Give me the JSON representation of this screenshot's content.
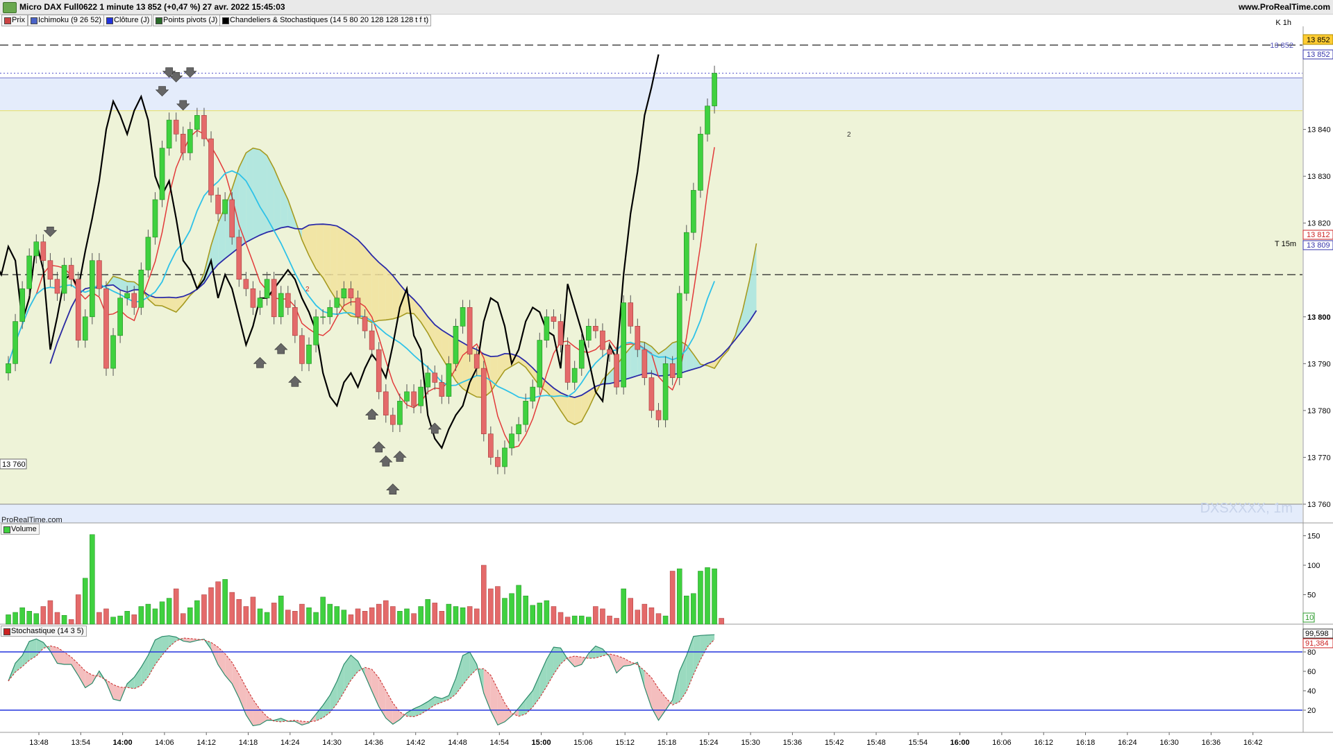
{
  "header": {
    "title": "Micro DAX Full0622 1 minute 13 852 (+0,47 %) 27 avr. 2022 15:45:03",
    "site": "www.ProRealTime.com"
  },
  "legend_tabs": [
    {
      "label": "Prix",
      "color": "#cc4444"
    },
    {
      "label": "Ichimoku (9 26 52)",
      "color": "#4a63c8"
    },
    {
      "label": "Clôture (J)",
      "color": "#2233dd"
    },
    {
      "label": "Points pivots (J)",
      "color": "#2a6b2a"
    },
    {
      "label": "Chandeliers & Stochastiques (14 5 80 20 128 128 128 t f t)",
      "color": "#000000"
    }
  ],
  "main_panel": {
    "watermark_brand": "ProRealTime.com",
    "watermark_symbol": "DXSXXXX, 1m",
    "level_k1h": "K 1h",
    "level_t15m": "T 15m",
    "price_tag_left": "13 760",
    "price_tags": [
      {
        "text": "13 852",
        "bg": "#ffcc33",
        "fg": "#000000"
      },
      {
        "text": "13 852",
        "bg": "#ffffff",
        "fg": "#3333aa"
      },
      {
        "text": "13 812",
        "bg": "#ffffff",
        "fg": "#cc2222"
      },
      {
        "text": "13 809",
        "bg": "#ffffff",
        "fg": "#3333aa"
      }
    ],
    "inline_label_852": "13 852",
    "marker_numbers": [
      "2",
      "2"
    ]
  },
  "volume_panel": {
    "label": "Volume",
    "last_tag": "10"
  },
  "stoch_panel": {
    "label": "Stochastique (14 3 5)",
    "tag_k": "99,598",
    "tag_d": "91,384"
  },
  "colors": {
    "up": "#3fd13f",
    "down": "#e46a6a",
    "ichimoku_cloud_green": "#a8e4e0",
    "ichimoku_cloud_red": "#f1e29c",
    "range_bg": "#eef3d8",
    "upper_band": "#e4ecfb"
  },
  "chart_data": {
    "type": "candlestick",
    "timeframe": "1 minute",
    "x_ticks": [
      "13:48",
      "13:54",
      "14:00",
      "14:06",
      "14:12",
      "14:18",
      "14:24",
      "14:30",
      "14:36",
      "14:42",
      "14:48",
      "14:54",
      "15:00",
      "15:06",
      "15:12",
      "15:18",
      "15:24",
      "15:30",
      "15:36",
      "15:42",
      "15:48",
      "15:54",
      "16:00",
      "16:06",
      "16:12",
      "16:18",
      "16:24",
      "16:30",
      "16:36",
      "16:42"
    ],
    "x_bold_ticks": [
      "14:00",
      "15:00",
      "16:00"
    ],
    "price_axis": {
      "ticks": [
        13760,
        13770,
        13780,
        13790,
        13800,
        13810,
        13820,
        13830,
        13840,
        13850
      ],
      "tick_labels": [
        "13 760",
        "13 770",
        "13 780",
        "13 790",
        "13 800",
        "13 820",
        "13 830",
        "13 840"
      ],
      "bold_tick": "13 800",
      "ylim": [
        13756,
        13862
      ]
    },
    "levels": {
      "k_1h": 13858,
      "upper_zone_top": 13851,
      "upper_zone_bottom": 13844,
      "t_15m": 13809,
      "range_low": 13760,
      "range_high": 13844
    },
    "candles_close": [
      13790,
      13799,
      13806,
      13813,
      13816,
      13812,
      13808,
      13805,
      13811,
      13808,
      13795,
      13800,
      13812,
      13806,
      13789,
      13796,
      13804,
      13805,
      13802,
      13810,
      13817,
      13825,
      13836,
      13842,
      13839,
      13835,
      13840,
      13843,
      13838,
      13826,
      13822,
      13825,
      13817,
      13808,
      13806,
      13802,
      13804,
      13808,
      13800,
      13805,
      13802,
      13796,
      13790,
      13794,
      13800,
      13800,
      13802,
      13804,
      13806,
      13804,
      13800,
      13797,
      13793,
      13784,
      13779,
      13777,
      13782,
      13784,
      13781,
      13785,
      13788,
      13786,
      13783,
      13790,
      13798,
      13802,
      13792,
      13789,
      13775,
      13770,
      13768,
      13772,
      13775,
      13777,
      13782,
      13785,
      13795,
      13800,
      13799,
      13794,
      13786,
      13789,
      13795,
      13798,
      13797,
      13793,
      13792,
      13785,
      13803,
      13798,
      13793,
      13787,
      13780,
      13778,
      13790,
      13787,
      13805,
      13818,
      13827,
      13839,
      13845,
      13852
    ],
    "volume": {
      "ylim": [
        0,
        160
      ],
      "ticks": [
        50,
        100,
        150
      ],
      "values": [
        16,
        20,
        28,
        22,
        18,
        30,
        40,
        20,
        15,
        8,
        50,
        78,
        152,
        20,
        26,
        12,
        14,
        22,
        16,
        30,
        34,
        26,
        38,
        44,
        60,
        18,
        28,
        40,
        50,
        62,
        72,
        76,
        54,
        42,
        30,
        46,
        26,
        20,
        36,
        48,
        24,
        22,
        34,
        28,
        20,
        46,
        34,
        30,
        24,
        16,
        26,
        22,
        28,
        34,
        40,
        30,
        22,
        26,
        18,
        30,
        42,
        36,
        22,
        34,
        30,
        28,
        30,
        26,
        100,
        60,
        64,
        44,
        52,
        66,
        48,
        32,
        36,
        40,
        30,
        20,
        12,
        14,
        14,
        12,
        30,
        26,
        14,
        10,
        60,
        44,
        24,
        34,
        28,
        18,
        14,
        90,
        94,
        48,
        52,
        90,
        96,
        94,
        10
      ]
    },
    "stochastic": {
      "ylim": [
        0,
        100
      ],
      "ticks": [
        20,
        40,
        60,
        80
      ],
      "overbought": 80,
      "oversold": 20,
      "last_k": 99.598,
      "last_d": 91.384
    }
  }
}
